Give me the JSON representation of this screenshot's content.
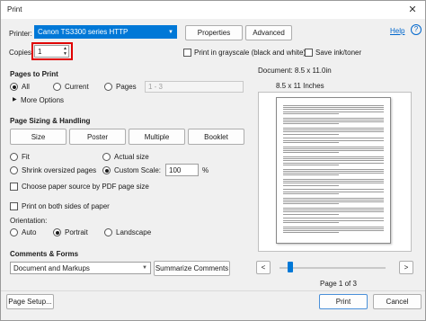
{
  "window": {
    "title": "Print",
    "close_glyph": "✕"
  },
  "printer": {
    "label": "Printer:",
    "selected": "Canon TS3300 series HTTP",
    "properties_button": "Properties",
    "advanced_button": "Advanced",
    "help_link": "Help"
  },
  "copies": {
    "label": "Copies:",
    "value": "1"
  },
  "options": {
    "grayscale_label": "Print in grayscale (black and white)",
    "save_ink_label": "Save ink/toner"
  },
  "pages_to_print": {
    "heading": "Pages to Print",
    "all_label": "All",
    "current_label": "Current",
    "pages_label": "Pages",
    "pages_range": "1 - 3",
    "more_options": "More Options",
    "selected": "All"
  },
  "sizing": {
    "heading": "Page Sizing & Handling",
    "tabs": [
      "Size",
      "Poster",
      "Multiple",
      "Booklet"
    ],
    "fit_label": "Fit",
    "actual_size_label": "Actual size",
    "shrink_label": "Shrink oversized pages",
    "custom_scale_label": "Custom Scale:",
    "custom_scale_value": "100",
    "percent": "%",
    "paper_source_label": "Choose paper source by PDF page size",
    "selected": "Custom Scale"
  },
  "duplex": {
    "both_sides_label": "Print on both sides of paper"
  },
  "orientation": {
    "heading": "Orientation:",
    "auto_label": "Auto",
    "portrait_label": "Portrait",
    "landscape_label": "Landscape",
    "selected": "Portrait"
  },
  "comments": {
    "heading": "Comments & Forms",
    "selected": "Document and Markups",
    "summarize_button": "Summarize Comments"
  },
  "preview": {
    "document_size": "Document: 8.5 x 11.0in",
    "paper_size": "8.5 x 11 Inches",
    "prev_glyph": "<",
    "next_glyph": ">",
    "page_indicator": "Page 1 of 3",
    "slider_position": 0.0
  },
  "footer": {
    "page_setup_button": "Page Setup...",
    "print_button": "Print",
    "cancel_button": "Cancel"
  },
  "colors": {
    "accent": "#0078d7",
    "highlight_box": "#e00000",
    "link": "#0066cc"
  },
  "icons": {
    "close": "close-icon",
    "caret": "chevron-down-icon",
    "more_options": "triangle-right-icon",
    "spinner": "spinner-arrows-icon"
  }
}
